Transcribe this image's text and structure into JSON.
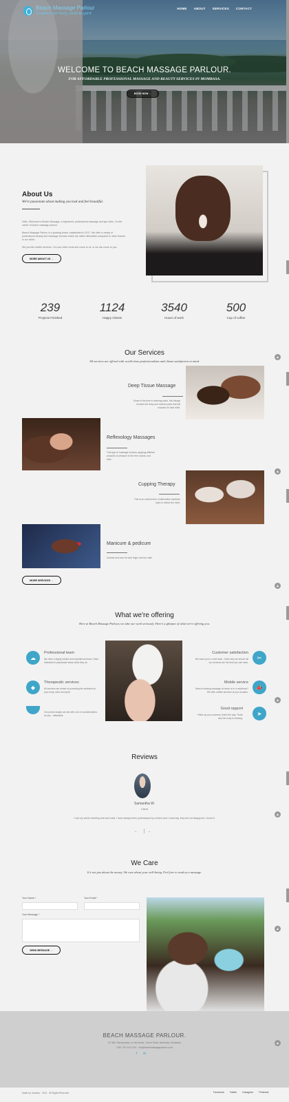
{
  "header": {
    "logo_name": "Beach Massage Parlour",
    "logo_tagline": "Treatment for body, mind & spirit",
    "nav": [
      "HOME",
      "ABOUT",
      "SERVICES",
      "CONTACT"
    ]
  },
  "hero": {
    "title": "WELCOME TO BEACH MASSAGE PARLOUR.",
    "subtitle": "FOR AFFORDABLE PROFESSIONAL MASSAGE AND BEAUTY SERVICES IN MOMBASA.",
    "button": "BOOK NOW →"
  },
  "about": {
    "title": "About Us",
    "subtitle": "We're passionate about making you look and feel beautiful.",
    "p1": "Hello, Welcome to Beach Massage, a registered, professional massage and spa clinic. I'm the owner of beach massage parlour.",
    "p2": "Beach Massage Parlour is a growing brand, established in 2017. We offer a variety of professional beauty and massage services which are rather affordable compared to other brands in our niche.",
    "p3": "We provide mobile services. You can either book and come to us, or we can come to you.",
    "button": "MORE ABOUT US →"
  },
  "stats": [
    {
      "value": "239",
      "label": "Projects Finished"
    },
    {
      "value": "1124",
      "label": "Happy Clients"
    },
    {
      "value": "3540",
      "label": "Hours of work"
    },
    {
      "value": "500",
      "label": "Cup of coffee"
    }
  ],
  "services": {
    "title": "Our Services",
    "subtitle": "All services are offered with world class professionalism and clients satisfaction in mind.",
    "items": [
      {
        "title": "Deep Tissue Massage",
        "desc": "Some of the time is relieving pains, this always focuses the deep and muscle pains that will muscles for total relief."
      },
      {
        "title": "Reflexology Massages",
        "desc": "This type of massage involves applying different amounts of pressure to the feet, hands, and ears."
      },
      {
        "title": "Cupping Therapy",
        "desc": "This is an ancient form of alternative medicine used to relieve the mind."
      },
      {
        "title": "Manicure & pedicure",
        "desc": "Cutests and care for both finger and toe nails."
      }
    ],
    "button": "MORE SERVICES →"
  },
  "offering": {
    "title": "What we're offering",
    "subtitle": "Here at Beach Massage Parlour, we take our work seriously. Here's a glimpse of what we're offering you.",
    "left": [
      {
        "title": "Professional team",
        "desc": "We have a highly trained and experienced team. Each individual is passionate about what they do.",
        "icon": "cloud-icon"
      },
      {
        "title": "Therapeutic services",
        "desc": "All services are aimed at promoting the wellness for your body, mind and spirit.",
        "icon": "diamond-icon"
      },
      {
        "title": "",
        "desc": "Our prices ranges are set with a lot of considerations for you - affordable.",
        "icon": "coin-icon"
      }
    ],
    "right": [
      {
        "title": "Customer satisfaction",
        "desc": "We want you to come back - that's why we ensure all our services are the best you can have.",
        "icon": "scissors-icon"
      },
      {
        "title": "Mobile service",
        "desc": "Want a relaxing massage at home or in a residence? We offer mobile services at your location.",
        "icon": "megaphone-icon"
      },
      {
        "title": "Good rapport",
        "desc": "Relax as you converse, that's the way. That's why the body is relaxing.",
        "icon": "send-icon"
      }
    ]
  },
  "reviews": {
    "title": "Reviews",
    "name": "Samantha W.",
    "role": "Client",
    "text": "I had my whole wedding look and nails. I have always been professional by a friend and I must say, they did not disappoint. I loved it.",
    "prev": "←",
    "next": "→"
  },
  "care": {
    "title": "We Care",
    "subtitle": "It's not just about the money. We care about your well-being. Feel free to send us a message.",
    "name_label": "Your Name *",
    "email_label": "Your Email *",
    "message_label": "Your Message *",
    "button": "SEND MESSAGE →"
  },
  "footer": {
    "title": "BEACH MASSAGE PARLOUR.",
    "address": "KF-MK: Shuwa plaza, on the beach, Corner Road, Mombasa, Mombasa",
    "contact": "+254 7XX XXX XXX · info@beachmassageparlour.co.ke",
    "copyright": "Made by: dmachu · 2021 · All Rights Reserved",
    "links": [
      "Facebook",
      "Twitter",
      "Instagram",
      "Pinterest"
    ]
  }
}
